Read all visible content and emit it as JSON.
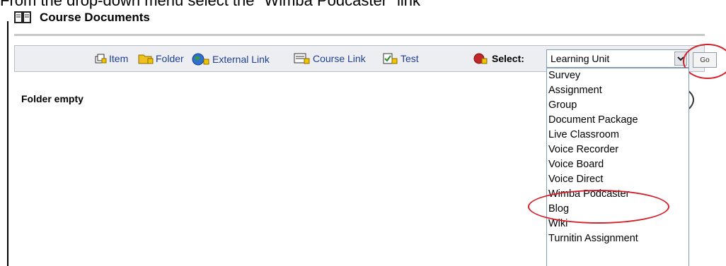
{
  "instruction": "From the drop-down menu select the \"Wimba Podcaster\" link",
  "page": {
    "title": "Course Documents"
  },
  "toolbar": {
    "links": [
      "Item",
      "Folder",
      "External Link",
      "Course Link",
      "Test"
    ],
    "select_label": "Select:",
    "selected_value": "Learning Unit",
    "go_label": "Go"
  },
  "content": {
    "empty_text": "Folder empty"
  },
  "dropdown_options": [
    "Survey",
    "Assignment",
    "Group",
    "Document Package",
    "Live Classroom",
    "Voice Recorder",
    "Voice Board",
    "Voice Direct",
    "Wimba Podcaster",
    "Blog",
    "Wiki",
    "Turnitin Assignment"
  ],
  "colors": {
    "link": "#1f3f8f",
    "annotation": "#d3202a",
    "toolbar_bg": "#eceef2"
  },
  "icons": [
    "book-icon",
    "item-icon",
    "folder-icon",
    "globe-icon",
    "course-link-icon",
    "test-icon",
    "add-select-icon",
    "chevron-down-icon"
  ]
}
